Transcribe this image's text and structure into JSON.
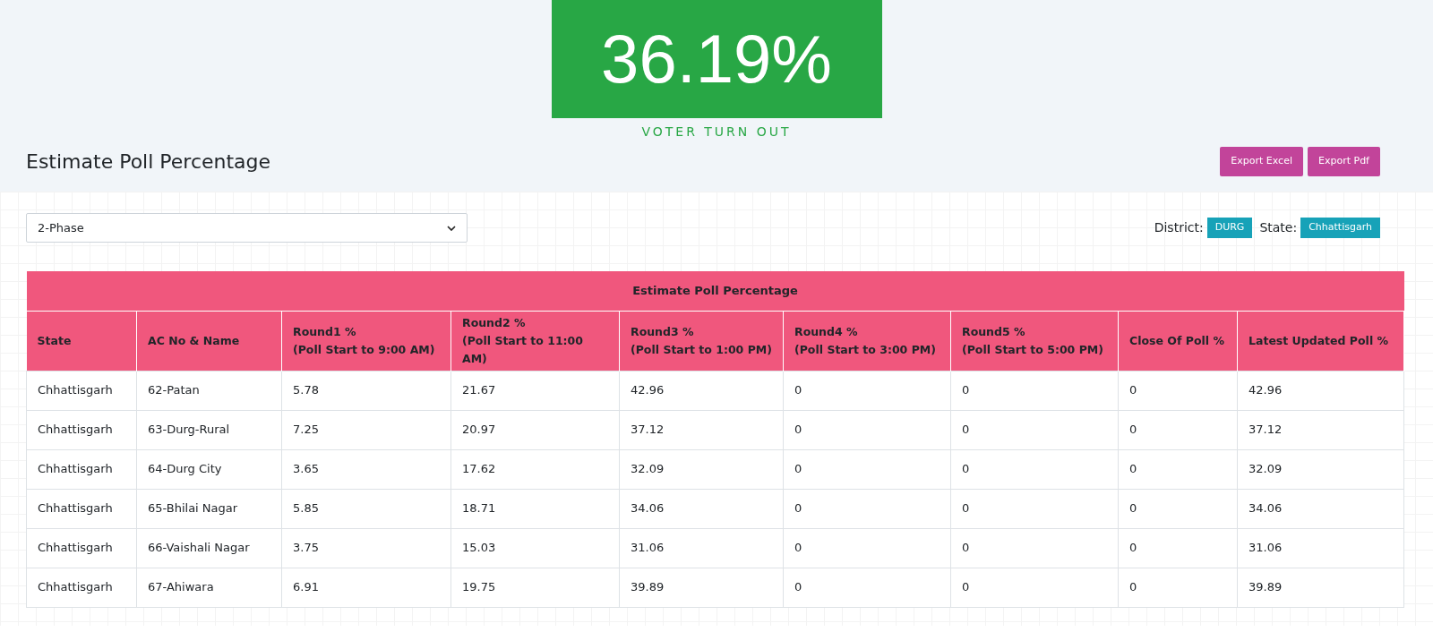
{
  "turnout": {
    "value": "36.19%",
    "label": "VOTER TURN OUT"
  },
  "heading": "Estimate Poll Percentage",
  "export_buttons": [
    "Export Excel",
    "Export Pdf"
  ],
  "phase_select": {
    "value": "2-Phase"
  },
  "filters": [
    {
      "label": "District:",
      "badge": "DURG"
    },
    {
      "label": "State:",
      "badge": "Chhattisgarh"
    }
  ],
  "table": {
    "title": "Estimate Poll Percentage",
    "columns": [
      {
        "title": "State"
      },
      {
        "title": "AC No & Name"
      },
      {
        "title": "Round1 %",
        "subtitle": "(Poll Start to 9:00 AM)"
      },
      {
        "title": "Round2 %",
        "subtitle": "(Poll Start to 11:00 AM)"
      },
      {
        "title": "Round3 %",
        "subtitle": "(Poll Start to 1:00 PM)"
      },
      {
        "title": "Round4 %",
        "subtitle": "(Poll Start to 3:00 PM)"
      },
      {
        "title": "Round5 %",
        "subtitle": "(Poll Start to 5:00 PM)"
      },
      {
        "title": "Close Of Poll %"
      },
      {
        "title": "Latest Updated Poll %"
      }
    ],
    "rows": [
      [
        "Chhattisgarh",
        "62-Patan",
        "5.78",
        "21.67",
        "42.96",
        "0",
        "0",
        "0",
        "42.96"
      ],
      [
        "Chhattisgarh",
        "63-Durg-Rural",
        "7.25",
        "20.97",
        "37.12",
        "0",
        "0",
        "0",
        "37.12"
      ],
      [
        "Chhattisgarh",
        "64-Durg City",
        "3.65",
        "17.62",
        "32.09",
        "0",
        "0",
        "0",
        "32.09"
      ],
      [
        "Chhattisgarh",
        "65-Bhilai Nagar",
        "5.85",
        "18.71",
        "34.06",
        "0",
        "0",
        "0",
        "34.06"
      ],
      [
        "Chhattisgarh",
        "66-Vaishali Nagar",
        "3.75",
        "15.03",
        "31.06",
        "0",
        "0",
        "0",
        "31.06"
      ],
      [
        "Chhattisgarh",
        "67-Ahiwara",
        "6.91",
        "19.75",
        "39.89",
        "0",
        "0",
        "0",
        "39.89"
      ]
    ]
  }
}
